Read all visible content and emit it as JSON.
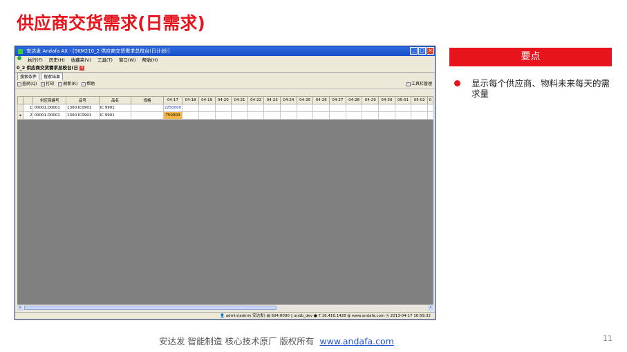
{
  "slide": {
    "title": "供应商交货需求(日需求)",
    "keypoint_label": "要点",
    "bullet": "显示每个供应商、物料未来每天的需求量",
    "footer_text": "安达发   智能制造 核心技术原厂    版权所有",
    "footer_link": "www.andafa.com",
    "page_number": "11"
  },
  "app": {
    "window_title": "安达发 Andafa AX - [SKM210_2 供应商交货需求总校台(日计划)]",
    "menu": [
      "执行(F)",
      "历史(H)",
      "收藏夹(V)",
      "工具(T)",
      "窗口(W)",
      "帮助(H)"
    ],
    "doc_tab": "0_2 供应商交货需求总校台(日",
    "tabs": [
      "搜索条件",
      "搜索结果"
    ],
    "toolbar": {
      "query": "查民(Q)",
      "print": "打印",
      "refresh": "刷新(R)",
      "help": "帮助",
      "manage": "工具栏管理"
    },
    "columns": [
      "供应商编号",
      "品号",
      "品名",
      "规格",
      "04-17",
      "04-18",
      "04-19",
      "04-20",
      "04-21",
      "04-22",
      "04-23",
      "04-24",
      "04-25",
      "04-26",
      "04-27",
      "04-28",
      "04-29",
      "04-30",
      "05-01",
      "05-02",
      "0"
    ],
    "rows": [
      {
        "no": "1",
        "supplier": "00001.D0001",
        "item": "1300.IC0901",
        "name": "IC 9901",
        "spec": "",
        "qty": "2250000"
      },
      {
        "no": "2",
        "supplier": "00001.D0001",
        "item": "1300.IC0901",
        "name": "IC 9901",
        "spec": "",
        "qty": "750000"
      }
    ],
    "status": {
      "user": "admin(admin 安达发)",
      "server": "S04:8090",
      "db": "andb_dev",
      "ip": "7.16.416.1428",
      "site": "www.andafa.com",
      "time": "2013-04-17 16:59:32"
    }
  }
}
